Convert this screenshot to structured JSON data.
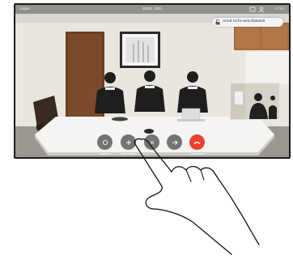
{
  "status": {
    "left": "Jaspin",
    "center": "38180, 2001",
    "right": "17:44"
  },
  "notice": {
    "text": "Anruf nicht verschlüsselt"
  },
  "controls": {
    "left_label": "Kamera",
    "add_label": "Hinzufügen",
    "end_label": "Beenden"
  },
  "colors": {
    "end_call": "#e8412f",
    "control_bg": "#505050",
    "wall": "#e6e3db"
  }
}
